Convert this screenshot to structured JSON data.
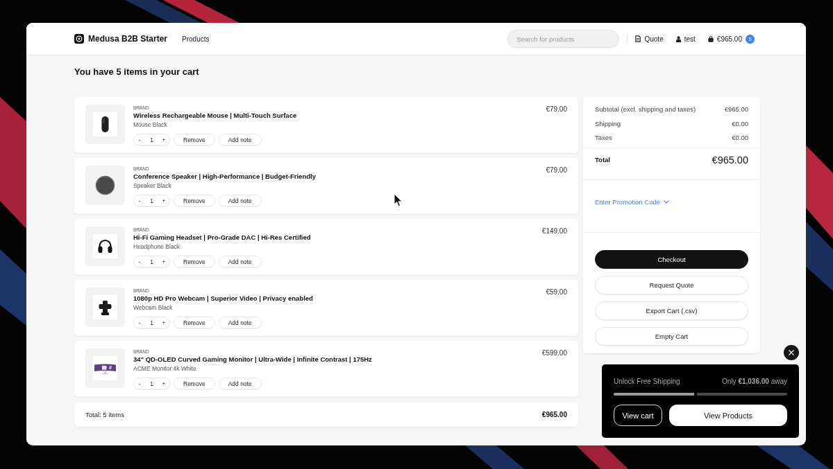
{
  "header": {
    "brand": "Medusa B2B Starter",
    "nav": [
      {
        "label": "Products"
      }
    ],
    "search": {
      "placeholder": "Search for products"
    },
    "quote": "Quote",
    "account": "test",
    "cart": {
      "total": "€965.00",
      "count": "5"
    }
  },
  "title": "You have 5 items in your cart",
  "items": [
    {
      "kind": "mouse",
      "brand": "BRAND",
      "name": "Wireless Rechargeable Mouse | Multi-Touch Surface",
      "variant": "Mouse Black",
      "decrement": "-",
      "quantity": "1",
      "increment": "+",
      "remove": "Remove",
      "add_note": "Add note",
      "price": "€79.00"
    },
    {
      "kind": "speaker",
      "brand": "BRAND",
      "name": "Conference Speaker | High-Performance | Budget-Friendly",
      "variant": "Speaker Black",
      "decrement": "-",
      "quantity": "1",
      "increment": "+",
      "remove": "Remove",
      "add_note": "Add note",
      "price": "€79.00"
    },
    {
      "kind": "headphones",
      "brand": "BRAND",
      "name": "Hi-Fi Gaming Headset | Pro-Grade DAC | Hi-Res Certified",
      "variant": "Headphone Black",
      "decrement": "-",
      "quantity": "1",
      "increment": "+",
      "remove": "Remove",
      "add_note": "Add note",
      "price": "€149.00"
    },
    {
      "kind": "webcam",
      "brand": "BRAND",
      "name": "1080p HD Pro Webcam | Superior Video | Privacy enabled",
      "variant": "Webcam Black",
      "decrement": "-",
      "quantity": "1",
      "increment": "+",
      "remove": "Remove",
      "add_note": "Add note",
      "price": "€59.00"
    },
    {
      "kind": "monitor",
      "brand": "BRAND",
      "name": "34\" QD-OLED Curved Gaming Monitor | Ultra-Wide | Infinite Contrast | 175Hz",
      "variant": "ACME Monitor 4k White",
      "decrement": "-",
      "quantity": "1",
      "increment": "+",
      "remove": "Remove",
      "add_note": "Add note",
      "price": "€599.00"
    }
  ],
  "items_total": {
    "label": "Total: 5 items",
    "value": "€965.00"
  },
  "summary": {
    "rows": [
      {
        "label": "Subtotal (excl. shipping and taxes)",
        "value": "€965.00"
      },
      {
        "label": "Shipping",
        "value": "€0.00"
      },
      {
        "label": "Taxes",
        "value": "€0.00"
      }
    ],
    "total": {
      "label": "Total",
      "value": "€965.00"
    },
    "promotion": "Enter Promotion Code",
    "buttons": [
      {
        "label": "Checkout",
        "kind": "primary"
      },
      {
        "label": "Request Quote",
        "kind": "secondary"
      },
      {
        "label": "Export Cart (.csv)",
        "kind": "secondary"
      },
      {
        "label": "Empty Cart",
        "kind": "secondary"
      }
    ]
  },
  "shipping_popup": {
    "label": "Unlock Free Shipping",
    "remaining": "Only **€1,036.00** away",
    "level": 0.48,
    "buttons": [
      {
        "label": "View cart",
        "kind": "outline"
      },
      {
        "label": "View Products",
        "kind": "filled"
      }
    ]
  }
}
